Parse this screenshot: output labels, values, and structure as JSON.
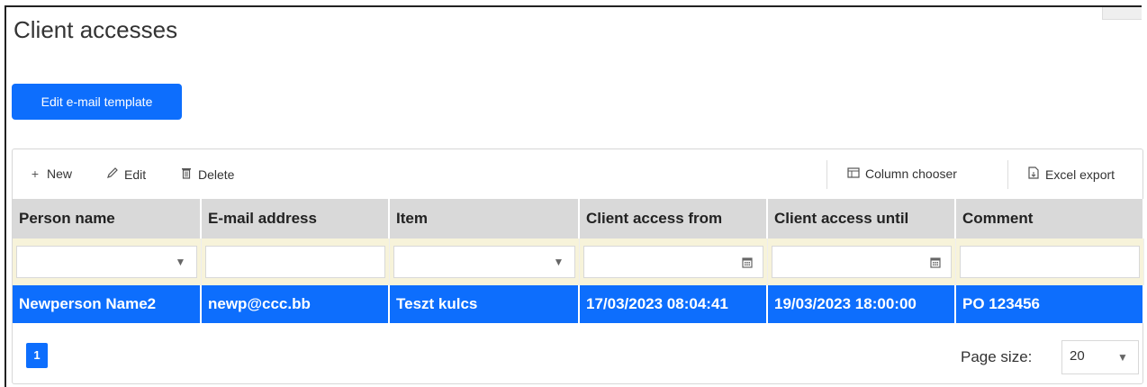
{
  "page": {
    "title": "Client accesses"
  },
  "actions": {
    "edit_template_label": "Edit e-mail template"
  },
  "toolbar": {
    "new_label": "New",
    "edit_label": "Edit",
    "delete_label": "Delete",
    "column_chooser_label": "Column chooser",
    "excel_export_label": "Excel export",
    "icons": {
      "new": "plus-icon",
      "edit": "pencil-icon",
      "delete": "trash-icon",
      "column_chooser": "column-chooser-icon",
      "excel_export": "export-file-icon"
    }
  },
  "table": {
    "columns": [
      "Person name",
      "E-mail address",
      "Item",
      "Client access from",
      "Client access until",
      "Comment"
    ],
    "filters": [
      {
        "value": "",
        "type": "dropdown"
      },
      {
        "value": "",
        "type": "text"
      },
      {
        "value": "",
        "type": "dropdown"
      },
      {
        "value": "",
        "type": "date"
      },
      {
        "value": "",
        "type": "date"
      },
      {
        "value": "",
        "type": "text"
      }
    ],
    "rows": [
      {
        "person_name": "Newperson Name2",
        "email": "newp@ccc.bb",
        "item": "Teszt kulcs",
        "access_from": "17/03/2023 08:04:41",
        "access_until": "19/03/2023 18:00:00",
        "comment": "PO 123456",
        "selected": true
      }
    ]
  },
  "pager": {
    "current_page": "1",
    "page_size_label": "Page size:",
    "page_size": "20"
  },
  "colors": {
    "accent": "#0d6efd",
    "header_bg": "#d9d9d9",
    "filter_bg": "#f7f3da"
  }
}
